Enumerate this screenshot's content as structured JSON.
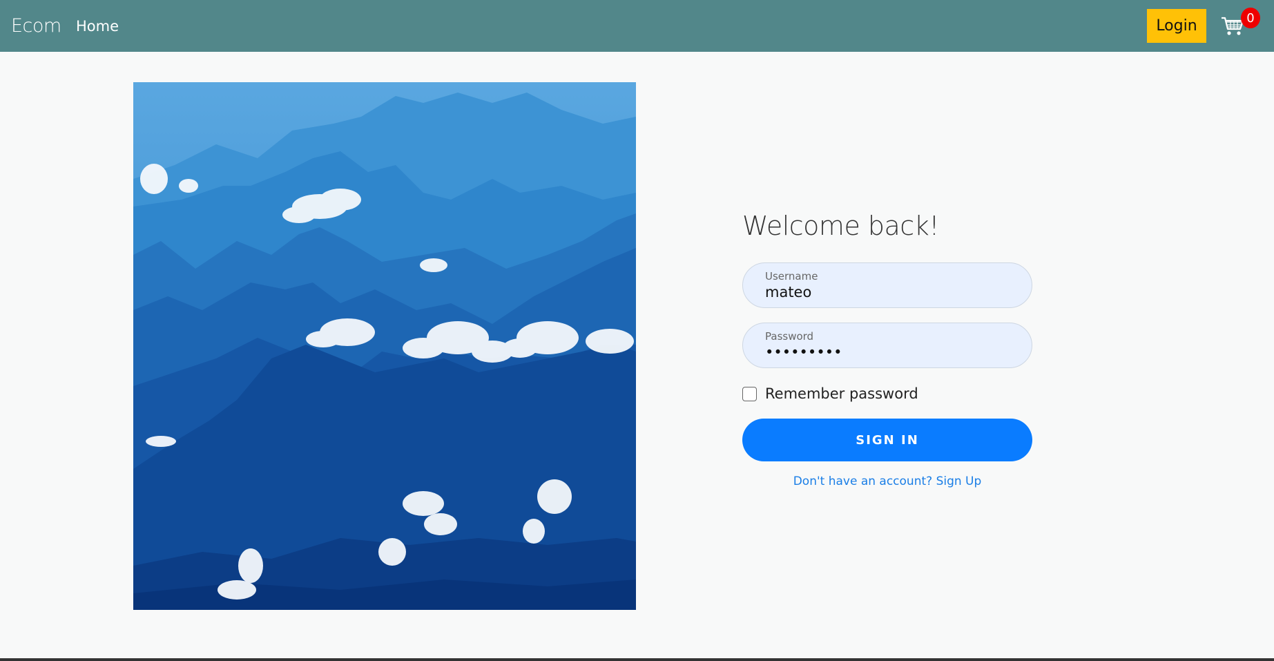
{
  "nav": {
    "brand": "Ecom",
    "home_label": "Home",
    "login_label": "Login",
    "cart_count": "0",
    "colors": {
      "navbar": "#52878a",
      "login": "#ffc107",
      "badge": "#ee0000"
    }
  },
  "hero": {
    "icon": "mountain-landscape-image"
  },
  "login_form": {
    "title": "Welcome back!",
    "username": {
      "label": "Username",
      "value": "mateo"
    },
    "password": {
      "label": "Password",
      "value": "•••••••••"
    },
    "remember_label": "Remember password",
    "remember_checked": false,
    "submit_label": "SIGN IN",
    "signup_text": "Don't have an account? Sign Up",
    "colors": {
      "submit": "#0a7cff",
      "link": "#1a7ee6",
      "field_bg": "#e8f0fe"
    }
  }
}
